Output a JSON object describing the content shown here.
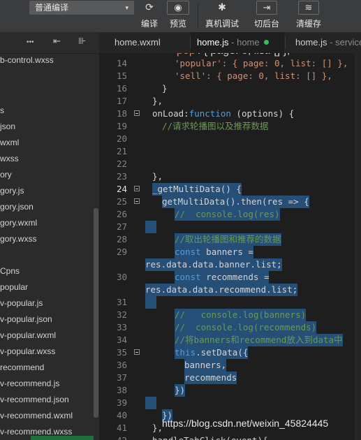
{
  "toolbar": {
    "compile_mode": "普通编译",
    "buttons": [
      {
        "label": "编译",
        "icon": "refresh-icon"
      },
      {
        "label": "预览",
        "icon": "eye-icon"
      },
      {
        "label": "真机调试",
        "icon": "bug-icon"
      },
      {
        "label": "切后台",
        "icon": "switch-icon"
      },
      {
        "label": "清缓存",
        "icon": "layers-icon"
      }
    ],
    "icons": {
      "refresh": "⟳",
      "eye": "◉",
      "bug": "✱",
      "switch": "⇥",
      "layers": "≋",
      "caret": "▾",
      "more": "•••",
      "collapse": "⇤",
      "split": "⊪"
    }
  },
  "sidebar": {
    "files": [
      "b-control.wxss",
      "s",
      "json",
      "wxml",
      "wxss",
      "ory",
      "gory.js",
      "gory.json",
      "gory.wxml",
      "gory.wxss",
      "Cpns",
      "popular",
      "v-popular.js",
      "v-popular.json",
      "v-popular.wxml",
      "v-popular.wxss",
      "recommend",
      "v-recommend.js",
      "v-recommend.json",
      "v-recommend.wxml",
      "v-recommend.wxss"
    ]
  },
  "tabs": [
    {
      "name": "home.wxml",
      "sub": ""
    },
    {
      "name": "home.js",
      "sub": " - home"
    },
    {
      "name": "home.js",
      "sub": " - service"
    }
  ],
  "editor": {
    "lines": [
      {
        "n": "14",
        "t": "'popular': { page: 0, list: [] },"
      },
      {
        "n": "15",
        "t": "'sell': { page: 0, list: [] },"
      },
      {
        "n": "16",
        "t": "}"
      },
      {
        "n": "17",
        "t": "},"
      },
      {
        "n": "18",
        "t": "onLoad:function (options) {"
      },
      {
        "n": "19",
        "t": "//请求轮播图以及推荐数据"
      },
      {
        "n": "20",
        "t": ""
      },
      {
        "n": "21",
        "t": ""
      },
      {
        "n": "22",
        "t": ""
      },
      {
        "n": "23",
        "t": "},"
      },
      {
        "n": "24",
        "t": "_getMultiData() {"
      },
      {
        "n": "25",
        "t": "getMultiData().then(res => {"
      },
      {
        "n": "26",
        "t": "//  console.log(res)"
      },
      {
        "n": "27",
        "t": ""
      },
      {
        "n": "28",
        "t": "//取出轮播图和推荐的数据"
      },
      {
        "n": "29",
        "t": "const banners ="
      },
      {
        "n": "",
        "t": "res.data.data.banner.list;"
      },
      {
        "n": "30",
        "t": "const recommends ="
      },
      {
        "n": "",
        "t": "res.data.data.recommend.list;"
      },
      {
        "n": "31",
        "t": ""
      },
      {
        "n": "32",
        "t": "//   console.log(banners)"
      },
      {
        "n": "33",
        "t": "//  console.log(recommends)"
      },
      {
        "n": "34",
        "t": "//将banners和recommend放入到data中"
      },
      {
        "n": "35",
        "t": "this.setData({"
      },
      {
        "n": "36",
        "t": "banners,"
      },
      {
        "n": "37",
        "t": "recommends"
      },
      {
        "n": "38",
        "t": "})"
      },
      {
        "n": "39",
        "t": ""
      },
      {
        "n": "40",
        "t": "})"
      },
      {
        "n": "41",
        "t": "},"
      },
      {
        "n": "42",
        "t": "handleTabClick(event){"
      }
    ]
  },
  "watermark": "https://blog.csdn.net/weixin_45824445",
  "colors": {
    "selection": "#264f78",
    "string": "#ce9178",
    "keyword": "#569cd6",
    "comment": "#6a9955",
    "modified_dot": "#2fbf5f"
  }
}
